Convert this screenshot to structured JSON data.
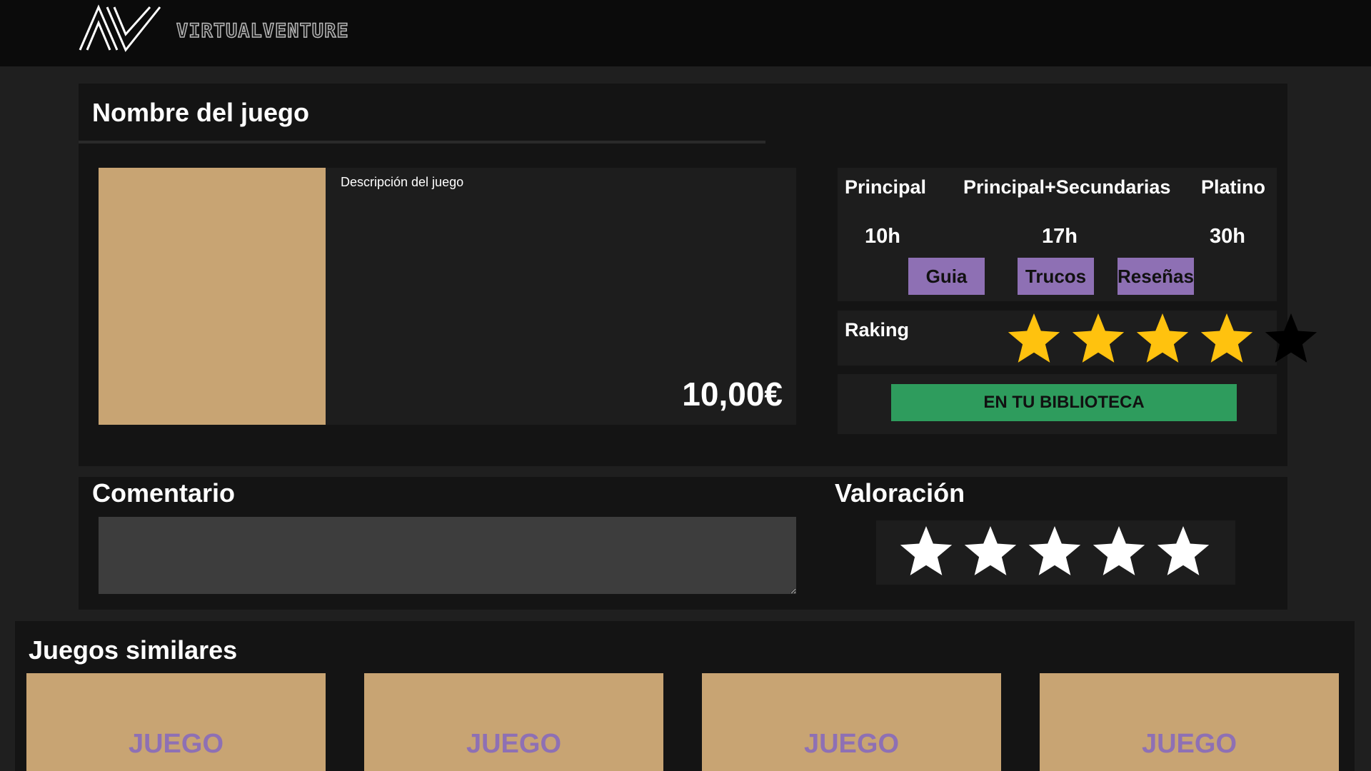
{
  "header": {
    "brand": "VIRTUALVENTURE",
    "logo_icon": "av-logo-icon"
  },
  "game": {
    "title": "Nombre del juego",
    "description": "Descripción del juego",
    "price": "10,00€",
    "cover_color": "#c8a473"
  },
  "stats": {
    "items": [
      {
        "label": "Principal",
        "value": "10h"
      },
      {
        "label": "Principal+Secundarias",
        "value": "17h"
      },
      {
        "label": "Platino",
        "value": "30h"
      }
    ]
  },
  "actions": {
    "guide": "Guia",
    "cheats": "Trucos",
    "reviews": "Reseñas",
    "library": "EN TU BIBLIOTECA"
  },
  "ranking": {
    "label": "Raking",
    "value": 4,
    "max": 5,
    "icon": "star-icon",
    "filled_color": "#ffc20e",
    "empty_color": "#000000"
  },
  "comment": {
    "title": "Comentario",
    "value": ""
  },
  "rating": {
    "title": "Valoración",
    "value": 0,
    "max": 5,
    "icon": "star-icon",
    "star_color": "#ffffff"
  },
  "similar": {
    "title": "Juegos similares",
    "cards": [
      {
        "label": "JUEGO"
      },
      {
        "label": "JUEGO"
      },
      {
        "label": "JUEGO"
      },
      {
        "label": "JUEGO"
      }
    ]
  },
  "colors": {
    "accent_purple": "#8e70b4",
    "library_green": "#2e9c5d",
    "background": "#1f1f1f",
    "panel": "#141414"
  }
}
